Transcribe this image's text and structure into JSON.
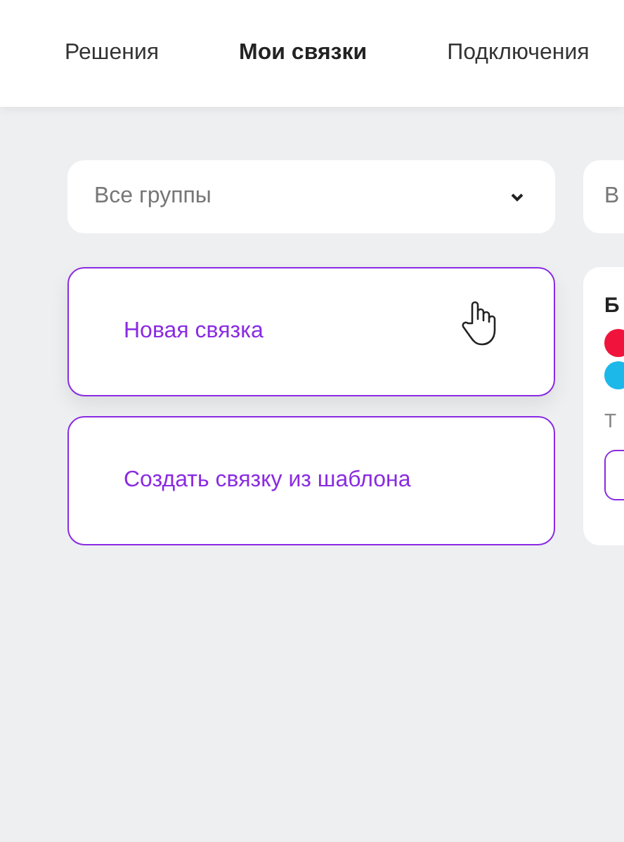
{
  "tabs": [
    {
      "label": "Решения",
      "selected": false
    },
    {
      "label": "Мои связки",
      "selected": true
    },
    {
      "label": "Подключения",
      "selected": false
    }
  ],
  "filters": [
    {
      "value": "Все группы"
    },
    {
      "value": "В"
    }
  ],
  "actions": [
    {
      "label": "Новая связка"
    },
    {
      "label": "Создать связку из шаблона"
    }
  ],
  "bundle_card": {
    "title": "Б",
    "apps": [
      {
        "color": "#f0143c"
      },
      {
        "color": "#1cb8ea"
      }
    ],
    "text": "Т"
  }
}
